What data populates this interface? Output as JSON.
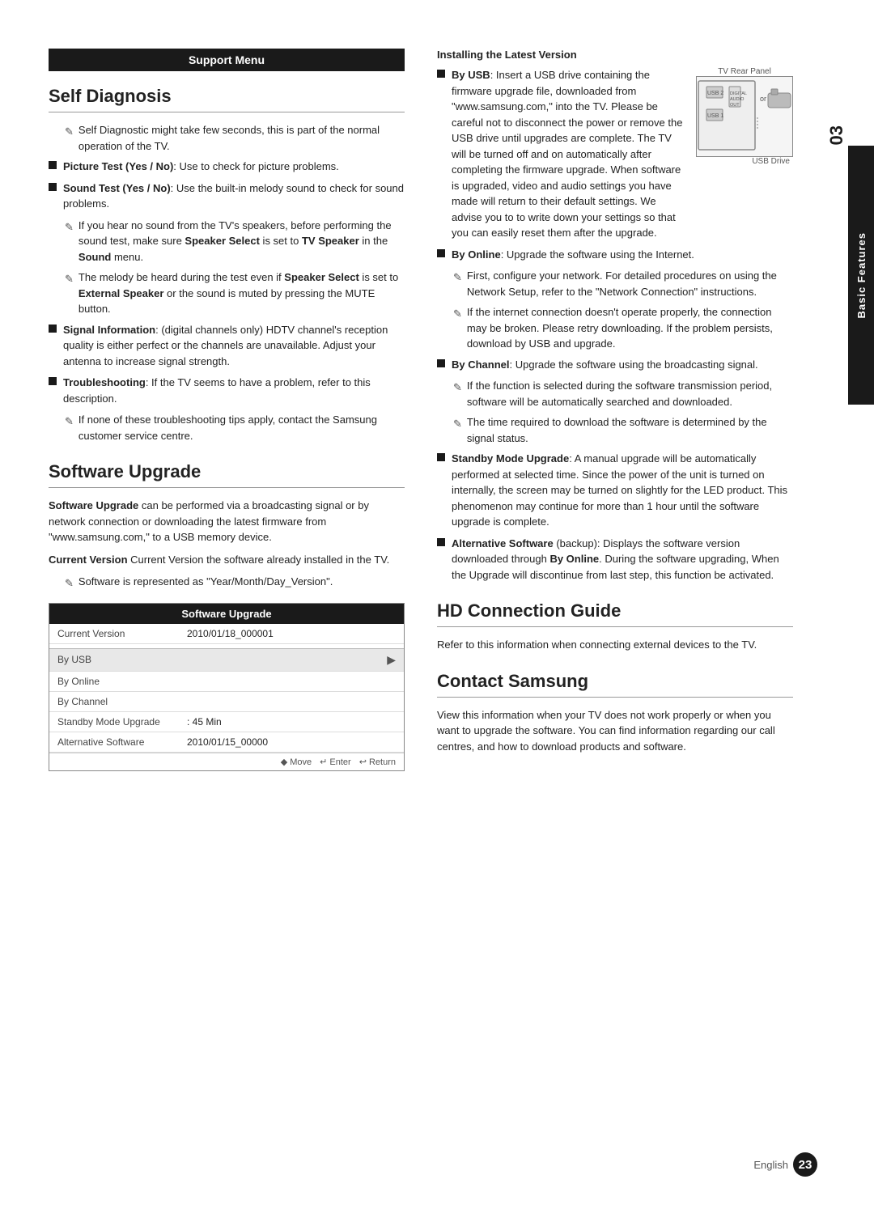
{
  "page": {
    "chapter": "03",
    "chapterTitle": "Basic Features",
    "pageNumber": "23",
    "pageLanguage": "English"
  },
  "supportMenu": {
    "header": "Support Menu"
  },
  "selfDiagnosis": {
    "title": "Self Diagnosis",
    "intro": "Self Diagnostic might take few seconds, this is part of the normal operation of the TV.",
    "bullets": [
      {
        "label": "Picture Test (Yes / No)",
        "text": ": Use to check for picture problems."
      },
      {
        "label": "Sound Test (Yes / No)",
        "text": ": Use the built-in melody sound to check for sound problems.",
        "subBullets": [
          "If you hear no sound from the TV's speakers, before performing the sound test, make sure Speaker Select is set to TV Speaker in the Sound menu.",
          "The melody be heard during the test even if Speaker Select is set to External Speaker or the sound is muted by pressing the MUTE button."
        ]
      },
      {
        "label": "Signal Information",
        "text": ": (digital channels only) HDTV channel's reception quality is either perfect or the channels are unavailable. Adjust your antenna to increase signal strength."
      },
      {
        "label": "Troubleshooting",
        "text": ": If the TV seems to have a problem, refer to this description.",
        "subBullets": [
          "If none of these troubleshooting tips apply, contact the Samsung customer service centre."
        ]
      }
    ]
  },
  "softwareUpgrade": {
    "title": "Software Upgrade",
    "intro1": "Software Upgrade can be performed via a broadcasting signal or by network connection or downloading the latest firmware from \"www.samsung.com,\" to a USB memory device.",
    "intro2": "Current Version the software already installed in the TV.",
    "intro3": "Software is represented as \"Year/Month/Day_Version\".",
    "tableHeader": "Software Upgrade",
    "tableRows": [
      {
        "label": "Current Version",
        "value": "2010/01/18_000001",
        "arrow": ""
      },
      {
        "label": "By USB",
        "value": "",
        "arrow": "▶",
        "highlighted": true
      },
      {
        "label": "By Online",
        "value": "",
        "arrow": ""
      },
      {
        "label": "By Channel",
        "value": "",
        "arrow": ""
      },
      {
        "label": "Standby Mode Upgrade",
        "value": ": 45 Min",
        "arrow": ""
      },
      {
        "label": "Alternative Software",
        "value": "2010/01/15_00000",
        "arrow": ""
      }
    ],
    "tableFooter": {
      "move": "◆ Move",
      "enter": "↵ Enter",
      "return": "↩ Return"
    }
  },
  "rightColumn": {
    "installingLatestVersion": {
      "title": "Installing the Latest Version",
      "tvRearPanelLabel": "TV Rear Panel",
      "usbDriveLabel": "USB Drive",
      "orLabel": "or",
      "byUSB": {
        "label": "By USB",
        "text": ": Insert a USB drive containing the firmware upgrade file, downloaded from \"www.samsung.com,\" into the TV. Please be careful not to disconnect the power or remove the USB drive until upgrades are complete. The TV will be turned off and on automatically after completing the firmware upgrade. When software is upgraded, video and audio settings you have made will return to their default settings. We advise you to to write down your settings so that you can easily reset them after the upgrade."
      },
      "byOnline": {
        "label": "By Online",
        "text": ": Upgrade the software using the Internet.",
        "subBullets": [
          "First, configure your network. For detailed procedures on using the Network Setup, refer to the \"Network Connection\" instructions.",
          "If the internet connection doesn't operate properly, the connection may be broken. Please retry downloading. If the problem persists, download by USB and upgrade."
        ]
      },
      "byChannel": {
        "label": "By Channel",
        "text": ": Upgrade the software using the broadcasting signal.",
        "subBullets": [
          "If the function is selected during the software transmission period, software will be automatically searched and downloaded.",
          "The time required to download the software is determined by the signal status."
        ]
      },
      "standbyModeUpgrade": {
        "label": "Standby Mode Upgrade",
        "text": ": A manual upgrade will be automatically performed at selected time. Since the power of the unit is turned on internally, the screen may be turned on slightly for the LED product. This phenomenon may continue for more than 1 hour until the software upgrade is complete."
      },
      "alternativeSoftware": {
        "label": "Alternative Software",
        "text": " (backup): Displays the software version downloaded through By Online. During the software upgrading, When the Upgrade will discontinue from last step, this function be activated."
      }
    },
    "hdConnectionGuide": {
      "title": "HD Connection Guide",
      "text": "Refer to this information when connecting external devices to the TV."
    },
    "contactSamsung": {
      "title": "Contact Samsung",
      "text": "View this information when your TV does not work properly or when you want to upgrade the software. You can find information regarding our call centres, and how to download products and software."
    }
  }
}
